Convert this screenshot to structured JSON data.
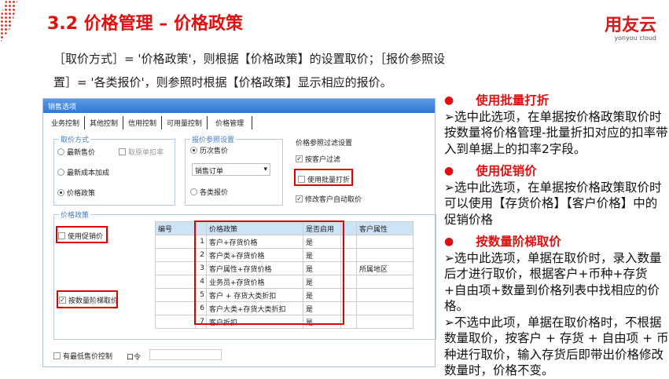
{
  "header": {
    "title": "3.2  价格管理 – 价格政策",
    "logo_main": "用友云",
    "logo_sub": "yonyou cloud"
  },
  "intro": "［取价方式］= '价格政策'，则根据【价格政策】的设置取价；［报价参照设置］= '各类报价'，则参照时根据【价格政策】显示相应的报价。",
  "dialog": {
    "title": "销售选项",
    "tabs": [
      "业务控制",
      "其他控制",
      "信用控制",
      "可用量控制",
      "价格管理"
    ],
    "price_method": {
      "label": "取价方式",
      "options": [
        "最新售价",
        "最新成本加成",
        "价格政策"
      ],
      "selected": "价格政策",
      "discount_checkbox": "取原单扣率"
    },
    "quote_ref": {
      "label": "报价参照设置",
      "options": [
        "历次售价",
        "各类报价"
      ],
      "selected": "历次售价",
      "select_value": "销售订单"
    },
    "filter": {
      "label": "价格参照过滤设置",
      "items": [
        {
          "label": "按客户过滤",
          "checked": true
        },
        {
          "label": "使用批量打折",
          "checked": false
        },
        {
          "label": "修改客户自动取价",
          "checked": true
        }
      ]
    },
    "policy": {
      "label": "价格政策",
      "use_promo": {
        "label": "使用促销价",
        "checked": false
      },
      "tiered": {
        "label": "按数量阶梯取价",
        "checked": true
      },
      "columns": [
        "编号",
        "价格政策",
        "是否启用",
        "客户属性"
      ],
      "rows": [
        {
          "n": "1",
          "policy": "客户+存货价格",
          "enabled": "是",
          "attr": ""
        },
        {
          "n": "2",
          "policy": "客户类+存货价格",
          "enabled": "是",
          "attr": ""
        },
        {
          "n": "3",
          "policy": "客户属性+存货价格",
          "enabled": "是",
          "attr": "所属地区"
        },
        {
          "n": "4",
          "policy": "业务员+存货价格",
          "enabled": "是",
          "attr": ""
        },
        {
          "n": "5",
          "policy": "客户 + 存货大类折扣",
          "enabled": "是",
          "attr": ""
        },
        {
          "n": "6",
          "policy": "客户大类+存货大类折扣",
          "enabled": "是",
          "attr": ""
        },
        {
          "n": "7",
          "policy": "客户折扣",
          "enabled": "是",
          "attr": ""
        }
      ]
    },
    "min_price": {
      "label": "有最低售价控制",
      "checked": false
    },
    "password_label": "口令"
  },
  "notes": [
    {
      "title": "使用批量打折",
      "paras": [
        "➢选中此选项，在单据按价格政策取价时按数量将价格管理-批量折扣对应的扣率带入到单据上的扣率2字段。"
      ]
    },
    {
      "title": "使用促销价",
      "paras": [
        "➢选中此选项，在单据按价格政策取价时可以使用【存货价格】【客户价格】中的促销价格"
      ]
    },
    {
      "title": "按数量阶梯取价",
      "paras": [
        "➢选中此选项，单据在取价时，录入数量后才进行取价，根据客户+币种+存货+自由项+数量到价格列表中找相应的价格。",
        "➢不选中此项，单据在取价格时，不根据数量取价，按客户 + 存货 + 自由项 + 币种进行取价，输入存货后即带出价格修改数量时，价格不变。"
      ]
    }
  ],
  "colors": {
    "accent": "#e01010",
    "titlebar": "#2f78d4"
  }
}
